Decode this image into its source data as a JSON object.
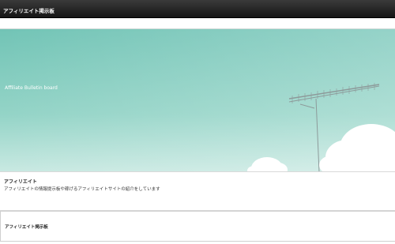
{
  "header": {
    "site_title": "アフィリエイト掲示板"
  },
  "hero": {
    "caption": "Affiliate Bulletin board",
    "image_icon": "sky-antenna-image",
    "colors": {
      "sky_top": "#7ecbbd",
      "sky_bottom": "#c7e8e1",
      "cloud": "#ffffff"
    }
  },
  "intro": {
    "heading": "アフィリエイト",
    "text": "アフィリエイトの情報提示板や稼げるアフィリエイトサイトの紹介をしています"
  },
  "board": {
    "heading": "アフィリエイト掲示板"
  },
  "colors": {
    "topbar": "#222222",
    "text": "#222222"
  }
}
